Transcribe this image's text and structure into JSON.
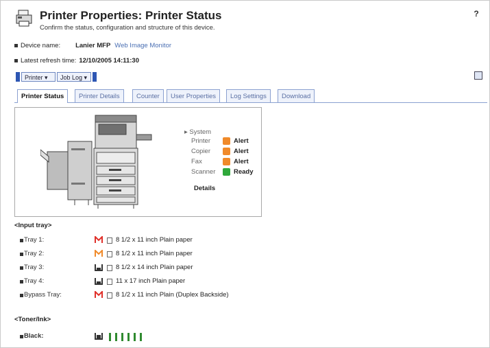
{
  "header": {
    "title": "Printer Properties: Printer Status",
    "subtitle": "Confirm the status, configuration and structure of this device.",
    "help_label": "?"
  },
  "device": {
    "name_label": "Device name:",
    "name_value": "Lanier MFP",
    "name_link": "Web Image Monitor",
    "refresh_label": "Latest refresh time:",
    "refresh_value": "12/10/2005 14:11:30"
  },
  "menus": [
    {
      "label": "Printer ▾"
    },
    {
      "label": "Job Log ▾"
    }
  ],
  "tabs": [
    {
      "label": "Printer Status",
      "active": true
    },
    {
      "label": "Printer Details"
    },
    {
      "label": "Counter"
    },
    {
      "label": "User Properties"
    },
    {
      "label": "Log Settings"
    },
    {
      "label": "Download"
    }
  ],
  "status": {
    "group_label": "System",
    "rows": [
      {
        "label": "Printer",
        "state": "Alert",
        "kind": "alert"
      },
      {
        "label": "Copier",
        "state": "Alert",
        "kind": "alert"
      },
      {
        "label": "Fax",
        "state": "Alert",
        "kind": "alert"
      },
      {
        "label": "Scanner",
        "state": "Ready",
        "kind": "ready"
      }
    ],
    "details_label": "Details"
  },
  "input_tray": {
    "heading": "<Input tray>",
    "trays": [
      {
        "label": "Tray 1:",
        "description": "8 1/2 x 11 inch Plain paper",
        "icon": "red-alert-icon"
      },
      {
        "label": "Tray 2:",
        "description": "8 1/2 x 11 inch Plain paper",
        "icon": "orange-warning-icon"
      },
      {
        "label": "Tray 3:",
        "description": "8 1/2 x 14 inch Plain paper",
        "icon": "tray-level-icon"
      },
      {
        "label": "Tray 4:",
        "description": "11 x 17 inch Plain paper",
        "icon": "tray-level-icon"
      },
      {
        "label": "Bypass Tray:",
        "description": "8 1/2 x 11 inch Plain (Duplex Backside)",
        "icon": "red-alert-icon"
      }
    ]
  },
  "toner": {
    "heading": "<Toner/Ink>",
    "items": [
      {
        "label": "Black:",
        "level": 1.0
      }
    ]
  },
  "colors": {
    "accent": "#2d56b3",
    "tab_border": "#8aa0d0",
    "alert": "#f08a2a",
    "ready": "#2fa83b",
    "toner": "#2f8a2f"
  }
}
